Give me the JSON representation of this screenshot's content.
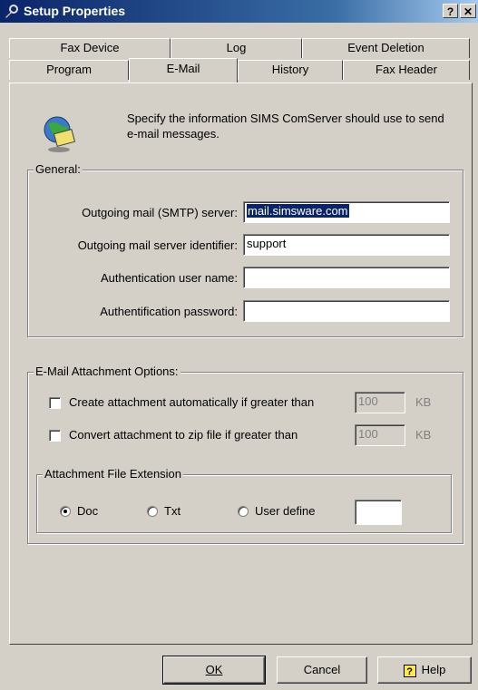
{
  "window": {
    "title": "Setup Properties",
    "help_button": "?",
    "close_button": "✕"
  },
  "tabs": {
    "row1": [
      "Fax Device",
      "Log",
      "Event Deletion"
    ],
    "row2": [
      "Program",
      "E-Mail",
      "History",
      "Fax Header"
    ],
    "active": "E-Mail"
  },
  "intro": {
    "text": "Specify the information SIMS ComServer should use to send e-mail messages."
  },
  "general": {
    "legend": "General:",
    "smtp_label": "Outgoing mail (SMTP) server:",
    "smtp_value": "mail.simsware.com",
    "identifier_label": "Outgoing mail server identifier:",
    "identifier_value": "support",
    "auth_user_label": "Authentication user name:",
    "auth_user_value": "",
    "auth_pass_label": "Authentification password:",
    "auth_pass_value": ""
  },
  "attachment": {
    "legend": "E-Mail Attachment Options:",
    "auto_label": "Create attachment automatically if greater than",
    "auto_checked": false,
    "auto_value": "100",
    "auto_unit": "KB",
    "zip_label": "Convert attachment to zip file if greater than",
    "zip_checked": false,
    "zip_value": "100",
    "zip_unit": "KB"
  },
  "extension": {
    "legend": "Attachment File Extension",
    "options": [
      "Doc",
      "Txt",
      "User define"
    ],
    "selected": "Doc",
    "user_define_value": ""
  },
  "buttons": {
    "ok": "OK",
    "cancel": "Cancel",
    "help": "Help"
  }
}
